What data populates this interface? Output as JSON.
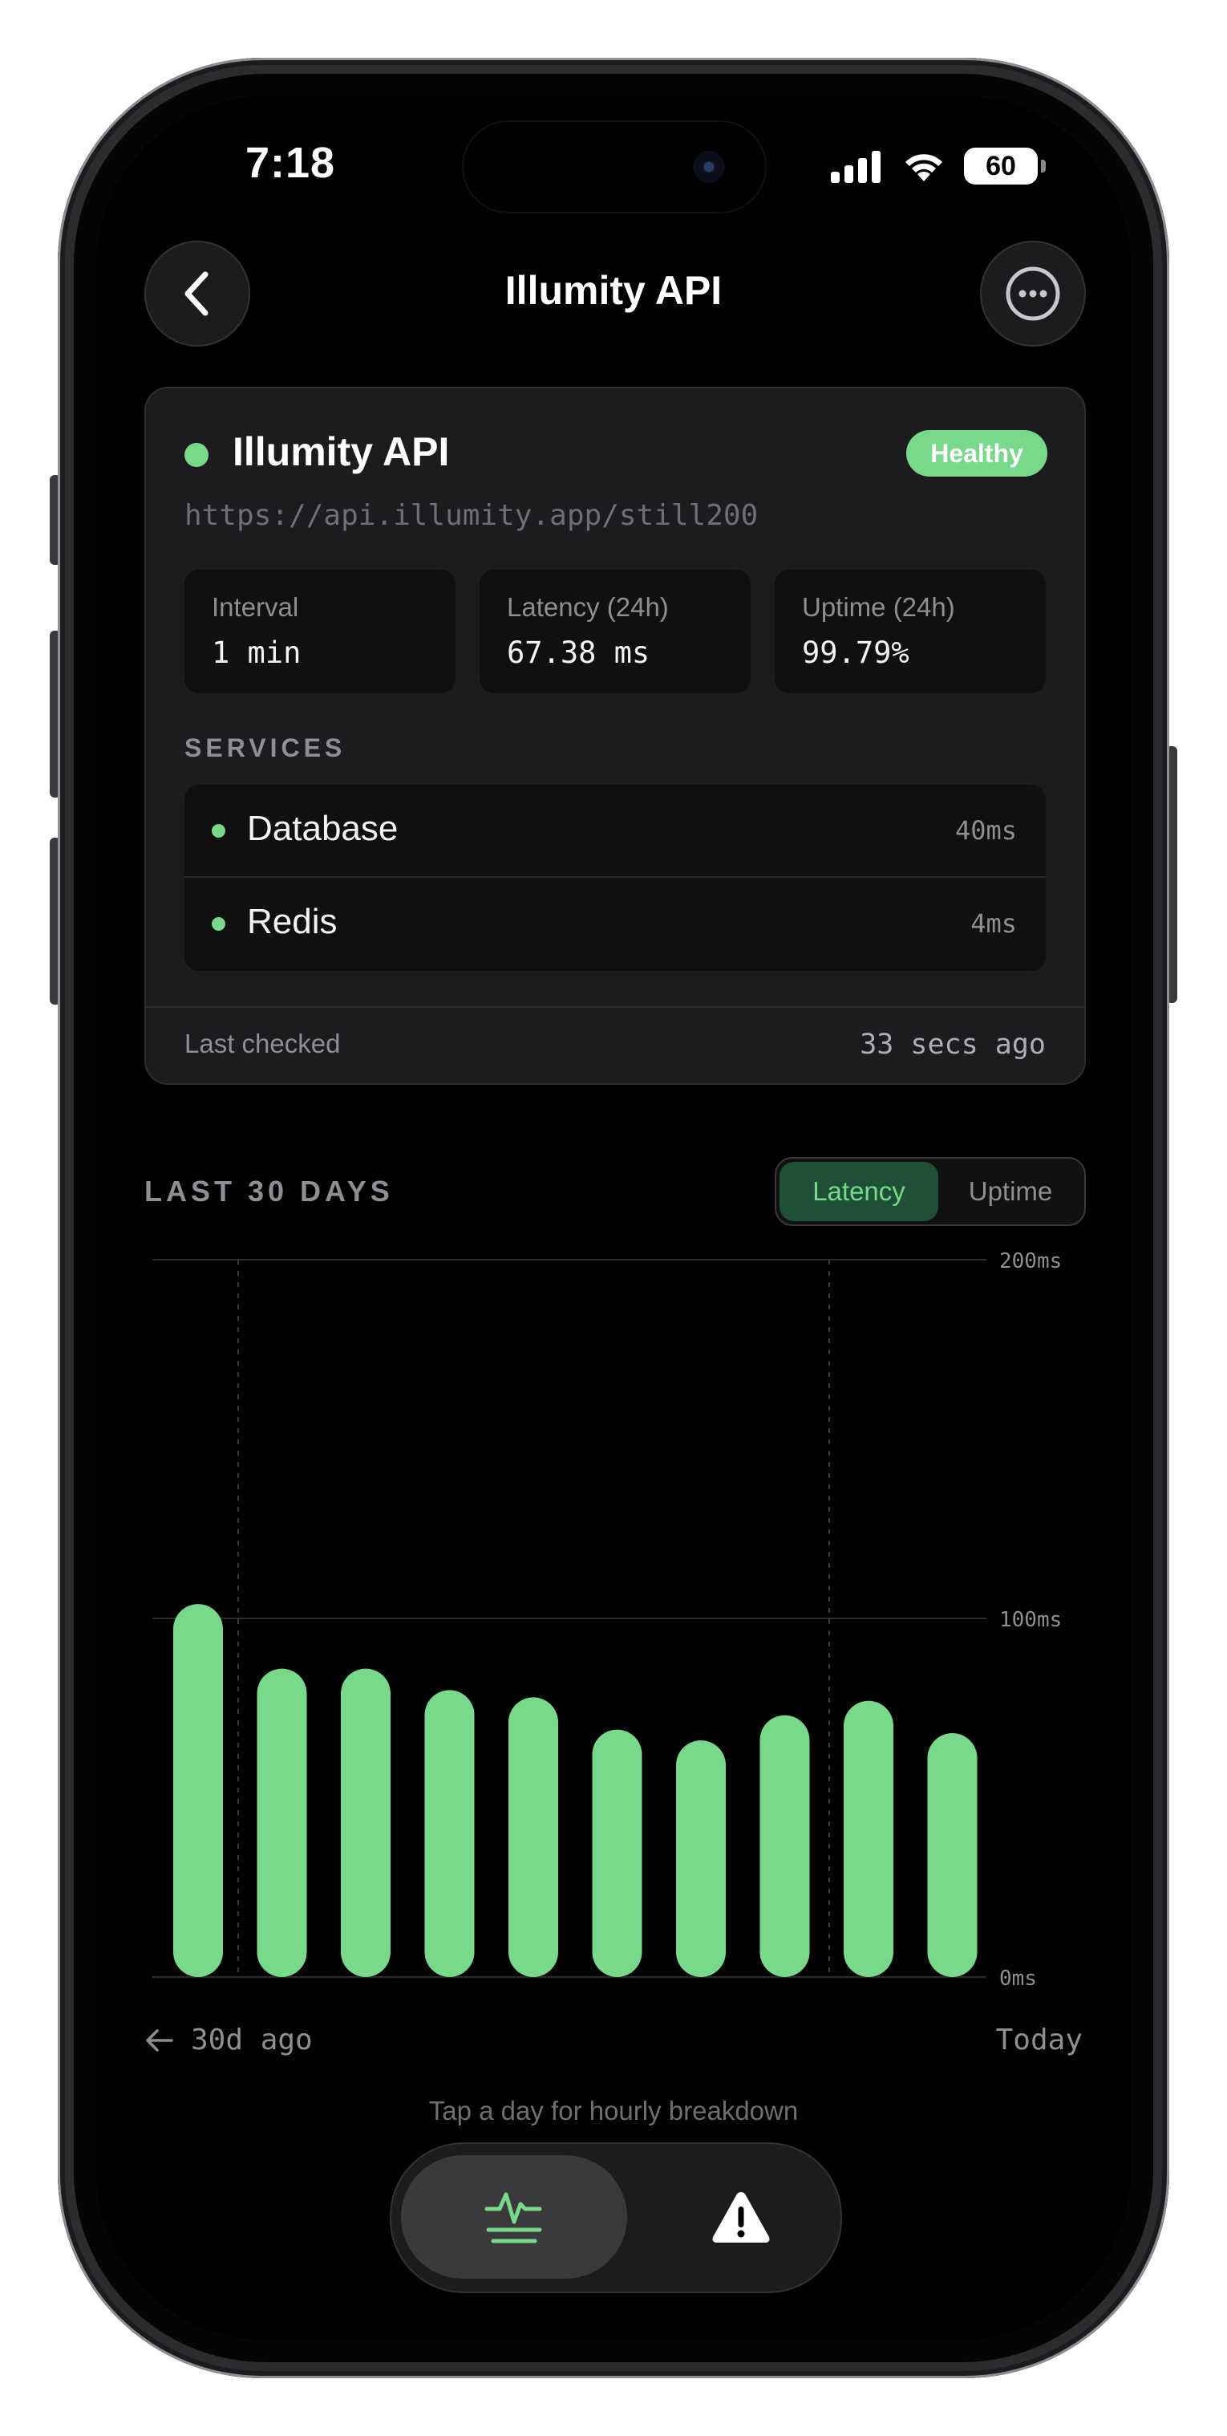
{
  "status_bar": {
    "time": "7:18",
    "battery": "60"
  },
  "nav": {
    "title": "Illumity API"
  },
  "monitor": {
    "name": "Illumity API",
    "status": "Healthy",
    "url": "https://api.illumity.app/still200",
    "stats": [
      {
        "label": "Interval",
        "value": "1 min"
      },
      {
        "label": "Latency (24h)",
        "value": "67.38 ms"
      },
      {
        "label": "Uptime (24h)",
        "value": "99.79%"
      }
    ],
    "services_header": "SERVICES",
    "services": [
      {
        "name": "Database",
        "latency": "40ms"
      },
      {
        "name": "Redis",
        "latency": "4ms"
      }
    ],
    "last_checked_label": "Last checked",
    "last_checked_value": "33 secs ago"
  },
  "history": {
    "title": "LAST 30 DAYS",
    "toggle": {
      "active": "Latency",
      "inactive": "Uptime"
    },
    "axis_start": "30d ago",
    "axis_end": "Today",
    "hint": "Tap a day for hourly breakdown"
  },
  "chart_data": {
    "type": "bar",
    "values": [
      104,
      86,
      86,
      80,
      78,
      69,
      66,
      73,
      77,
      68
    ],
    "ylim": [
      0,
      200
    ],
    "yticks": [
      "200ms",
      "100ms",
      "0ms"
    ],
    "bar_color": "#79d98a",
    "grid": true
  },
  "colors": {
    "accent": "#79d98a",
    "background": "#000000"
  },
  "tabbar": {
    "items": [
      "pulse-icon",
      "warning-icon"
    ]
  }
}
